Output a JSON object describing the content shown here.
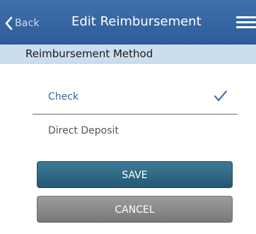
{
  "header": {
    "back_label": "Back",
    "title": "Edit Reimbursement",
    "back_icon": "chevron-left-icon",
    "menu_icon": "hamburger-menu-icon"
  },
  "section": {
    "title": "Reimbursement Method"
  },
  "options": [
    {
      "label": "Check",
      "selected": true,
      "icon": "checkmark-icon"
    },
    {
      "label": "Direct Deposit",
      "selected": false
    }
  ],
  "buttons": {
    "save_label": "SAVE",
    "cancel_label": "CANCEL"
  },
  "colors": {
    "header_bg": "#3a69a6",
    "section_bg": "#ccddef",
    "selected_text": "#34679e",
    "save_bg": "#2e6582",
    "cancel_bg": "#8a8a8a"
  }
}
